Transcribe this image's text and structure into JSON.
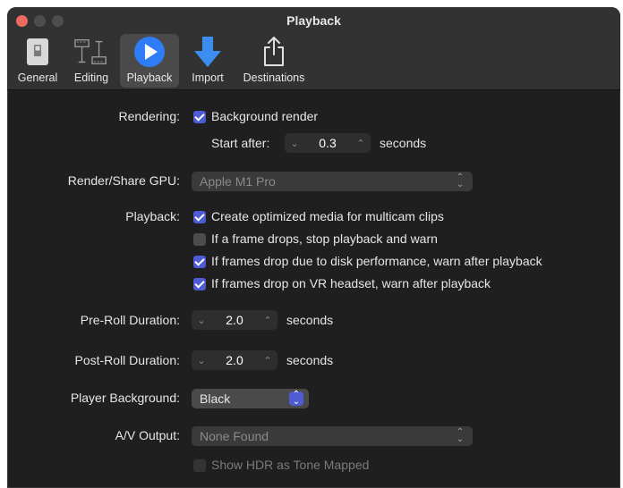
{
  "window": {
    "title": "Playback"
  },
  "toolbar": {
    "tabs": [
      {
        "label": "General",
        "icon": "switch-icon"
      },
      {
        "label": "Editing",
        "icon": "film-strip-icon"
      },
      {
        "label": "Playback",
        "icon": "play-icon",
        "selected": true
      },
      {
        "label": "Import",
        "icon": "down-arrow-icon"
      },
      {
        "label": "Destinations",
        "icon": "share-icon"
      }
    ]
  },
  "settings": {
    "rendering": {
      "label": "Rendering:",
      "checkbox_label": "Background render",
      "checked": true
    },
    "start_after": {
      "label": "Start after:",
      "value": "0.3",
      "unit": "seconds"
    },
    "gpu": {
      "label": "Render/Share GPU:",
      "value": "Apple M1 Pro"
    },
    "playback": {
      "label": "Playback:",
      "options": [
        {
          "label": "Create optimized media for multicam clips",
          "checked": true
        },
        {
          "label": "If a frame drops, stop playback and warn",
          "checked": false
        },
        {
          "label": "If frames drop due to disk performance, warn after playback",
          "checked": true
        },
        {
          "label": "If frames drop on VR headset, warn after playback",
          "checked": true
        }
      ]
    },
    "preroll": {
      "label": "Pre-Roll Duration:",
      "value": "2.0",
      "unit": "seconds"
    },
    "postroll": {
      "label": "Post-Roll Duration:",
      "value": "2.0",
      "unit": "seconds"
    },
    "player_background": {
      "label": "Player Background:",
      "value": "Black"
    },
    "av_output": {
      "label": "A/V Output:",
      "value": "None Found"
    },
    "hdr": {
      "label": "Show HDR as Tone Mapped",
      "checked": false
    }
  },
  "colors": {
    "accent": "#4f5bd5",
    "background": "#1f1f1f",
    "toolbar": "#323232"
  }
}
